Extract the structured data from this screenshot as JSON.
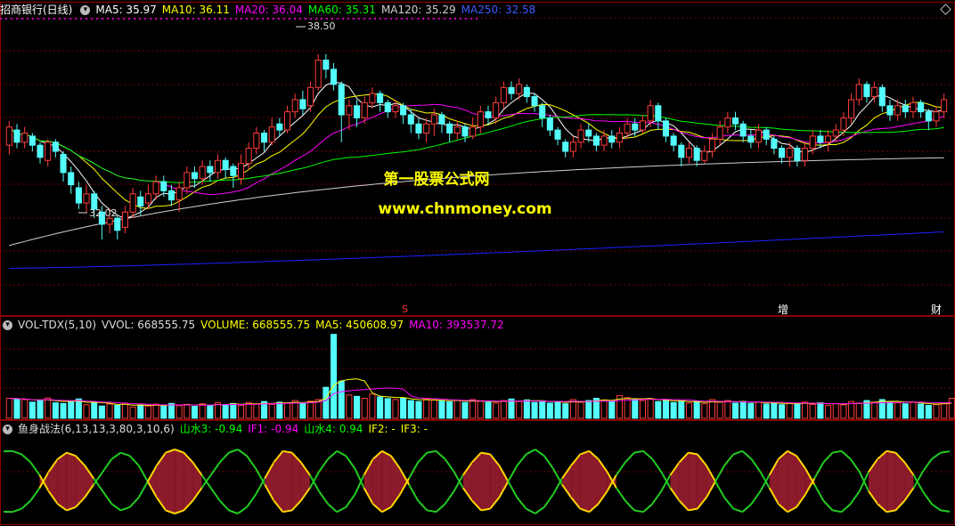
{
  "main_header": {
    "title": "招商银行(日线)",
    "ma5": "MA5: 35.97",
    "ma10": "MA10: 36.11",
    "ma20": "MA20: 36.04",
    "ma60": "MA60: 35.31",
    "ma120": "MA120: 35.29",
    "ma250": "MA250: 32.58"
  },
  "vol_header": {
    "name": "VOL-TDX(5,10)",
    "vvol": "VVOL: 668555.75",
    "volume": "VOLUME: 668555.75",
    "ma5": "MA5: 450608.97",
    "ma10": "MA10: 393537.72"
  },
  "ind_header": {
    "name": "鱼身战法(6,13,13,3,80,3,10,6)",
    "s3": "山水3: -0.94",
    "if1": "IF1: -0.94",
    "s4": "山水4: 0.94",
    "if2": "IF2: -",
    "if3": "IF3: -"
  },
  "watermark": {
    "line1": "第一股票公式网",
    "line2": "www.chnmoney.com"
  },
  "marks": {
    "high": "38.50",
    "low": "32.02",
    "s": "S",
    "zeng": "增",
    "cai": "财"
  },
  "colors": {
    "up": "#ff3c3c",
    "down": "#54fcfc",
    "ma5": "#ffffff",
    "ma10": "#ffff00",
    "ma20": "#ff00ff",
    "ma60": "#00ff00",
    "ma120": "#d0d0d0",
    "ma250": "#2020ff",
    "fish_fill": "#8b1a2b",
    "fish_edge": "#ffd700",
    "fish_line": "#22cc22",
    "accent": "#dd44dd"
  },
  "chart_data": [
    {
      "type": "candlestick",
      "title": "招商银行(日线)",
      "price_high_label": 38.5,
      "price_low_label": 32.02,
      "ylim": [
        31.2,
        39.4
      ],
      "grid": true,
      "ma_last": {
        "MA5": 35.97,
        "MA10": 36.11,
        "MA20": 36.04,
        "MA60": 35.31,
        "MA120": 35.29,
        "MA250": 32.58
      },
      "candles": [
        [
          35.5,
          36.1,
          36.3,
          35.2
        ],
        [
          36.0,
          35.6,
          36.2,
          35.4
        ],
        [
          35.6,
          35.9,
          36.1,
          35.4
        ],
        [
          35.8,
          35.5,
          35.9,
          35.3
        ],
        [
          35.5,
          35.1,
          35.6,
          34.9
        ],
        [
          35.0,
          35.6,
          35.7,
          34.8
        ],
        [
          35.6,
          35.3,
          35.7,
          35.1
        ],
        [
          35.2,
          34.6,
          35.3,
          34.3
        ],
        [
          34.6,
          34.2,
          34.8,
          33.9
        ],
        [
          34.1,
          33.6,
          34.3,
          33.4
        ],
        [
          33.6,
          33.9,
          34.2,
          33.3
        ],
        [
          33.9,
          33.4,
          34.0,
          33.1
        ],
        [
          33.3,
          32.9,
          33.5,
          32.4
        ],
        [
          32.9,
          33.1,
          33.4,
          32.6
        ],
        [
          33.1,
          32.7,
          33.2,
          32.4
        ],
        [
          32.8,
          33.3,
          33.5,
          32.6
        ],
        [
          33.3,
          33.9,
          34.1,
          33.1
        ],
        [
          33.8,
          33.5,
          34.0,
          33.2
        ],
        [
          33.6,
          33.9,
          34.2,
          33.4
        ],
        [
          33.9,
          34.3,
          34.5,
          33.7
        ],
        [
          34.3,
          34.0,
          34.5,
          33.8
        ],
        [
          34.0,
          33.7,
          34.2,
          33.5
        ],
        [
          33.7,
          34.1,
          34.3,
          33.3
        ],
        [
          34.1,
          34.6,
          34.8,
          33.9
        ],
        [
          34.6,
          34.4,
          34.8,
          34.1
        ],
        [
          34.4,
          34.8,
          35.0,
          34.2
        ],
        [
          34.8,
          34.6,
          35.0,
          34.3
        ],
        [
          34.6,
          35.0,
          35.2,
          34.4
        ],
        [
          35.0,
          34.7,
          35.1,
          34.4
        ],
        [
          34.8,
          34.5,
          34.9,
          34.1
        ],
        [
          34.4,
          34.9,
          35.2,
          34.2
        ],
        [
          34.9,
          35.4,
          35.6,
          34.7
        ],
        [
          35.4,
          35.9,
          36.1,
          35.2
        ],
        [
          35.9,
          35.6,
          36.0,
          35.3
        ],
        [
          35.6,
          36.1,
          36.4,
          35.5
        ],
        [
          36.2,
          36.0,
          36.4,
          35.8
        ],
        [
          36.0,
          36.6,
          36.8,
          35.9
        ],
        [
          36.6,
          37.0,
          37.2,
          36.4
        ],
        [
          37.0,
          36.7,
          37.3,
          36.5
        ],
        [
          36.8,
          37.4,
          37.6,
          36.6
        ],
        [
          37.4,
          38.3,
          38.5,
          37.3
        ],
        [
          38.3,
          38.0,
          38.5,
          37.7
        ],
        [
          38.0,
          37.5,
          38.2,
          37.3
        ],
        [
          37.5,
          36.5,
          37.6,
          35.6
        ],
        [
          36.5,
          36.8,
          37.0,
          36.0
        ],
        [
          36.8,
          36.4,
          37.0,
          36.1
        ],
        [
          36.4,
          36.9,
          37.1,
          36.2
        ],
        [
          36.9,
          37.2,
          37.4,
          36.7
        ],
        [
          37.2,
          36.9,
          37.3,
          36.6
        ],
        [
          36.9,
          36.6,
          37.0,
          36.4
        ],
        [
          36.6,
          36.8,
          37.0,
          36.4
        ],
        [
          36.8,
          36.5,
          36.9,
          36.2
        ],
        [
          36.5,
          36.2,
          36.7,
          35.9
        ],
        [
          36.2,
          35.9,
          36.4,
          35.7
        ],
        [
          35.9,
          36.2,
          36.4,
          35.6
        ],
        [
          36.2,
          36.5,
          36.7,
          35.8
        ],
        [
          36.5,
          36.2,
          36.6,
          35.9
        ],
        [
          36.2,
          35.9,
          36.3,
          35.6
        ],
        [
          35.9,
          36.1,
          36.3,
          35.7
        ],
        [
          36.1,
          35.8,
          36.2,
          35.6
        ],
        [
          35.8,
          36.1,
          36.4,
          35.7
        ],
        [
          36.1,
          36.6,
          36.8,
          35.9
        ],
        [
          36.6,
          36.4,
          36.8,
          36.2
        ],
        [
          36.4,
          36.9,
          37.1,
          36.2
        ],
        [
          36.9,
          37.4,
          37.6,
          36.7
        ],
        [
          37.4,
          37.2,
          37.6,
          37.0
        ],
        [
          37.2,
          37.5,
          37.7,
          37.0
        ],
        [
          37.4,
          37.1,
          37.5,
          36.9
        ],
        [
          37.1,
          36.8,
          37.2,
          36.6
        ],
        [
          36.8,
          36.4,
          36.9,
          36.1
        ],
        [
          36.4,
          36.0,
          36.5,
          35.8
        ],
        [
          36.0,
          35.7,
          36.1,
          35.5
        ],
        [
          35.6,
          35.3,
          35.7,
          35.1
        ],
        [
          35.3,
          35.6,
          35.8,
          35.1
        ],
        [
          35.6,
          36.0,
          36.2,
          35.4
        ],
        [
          36.0,
          35.8,
          36.2,
          35.6
        ],
        [
          35.8,
          35.5,
          35.9,
          35.3
        ],
        [
          35.5,
          35.8,
          36.0,
          35.3
        ],
        [
          35.8,
          35.6,
          36.0,
          35.4
        ],
        [
          35.6,
          35.9,
          36.1,
          35.4
        ],
        [
          35.9,
          36.2,
          36.4,
          35.7
        ],
        [
          36.2,
          36.0,
          36.4,
          35.8
        ],
        [
          36.0,
          36.3,
          36.5,
          35.9
        ],
        [
          36.3,
          36.8,
          37.0,
          36.1
        ],
        [
          36.8,
          36.3,
          36.9,
          36.0
        ],
        [
          36.3,
          35.8,
          36.4,
          35.6
        ],
        [
          35.8,
          35.5,
          35.9,
          35.3
        ],
        [
          35.5,
          35.1,
          35.6,
          34.8
        ],
        [
          35.1,
          35.4,
          35.6,
          34.9
        ],
        [
          35.4,
          35.0,
          35.5,
          34.8
        ],
        [
          35.0,
          35.3,
          35.5,
          34.9
        ],
        [
          35.3,
          35.7,
          35.9,
          35.1
        ],
        [
          35.7,
          36.1,
          36.3,
          35.5
        ],
        [
          36.1,
          36.4,
          36.6,
          35.9
        ],
        [
          36.4,
          36.2,
          36.6,
          36.0
        ],
        [
          36.2,
          35.8,
          36.3,
          35.6
        ],
        [
          35.8,
          35.6,
          36.0,
          35.4
        ],
        [
          35.6,
          36.0,
          36.2,
          35.4
        ],
        [
          36.0,
          35.7,
          36.1,
          35.5
        ],
        [
          35.7,
          35.4,
          35.8,
          35.2
        ],
        [
          35.4,
          35.1,
          35.5,
          34.9
        ],
        [
          35.1,
          35.4,
          35.6,
          34.8
        ],
        [
          35.4,
          35.0,
          35.5,
          34.8
        ],
        [
          35.0,
          35.4,
          35.6,
          34.8
        ],
        [
          35.4,
          35.8,
          36.0,
          35.2
        ],
        [
          35.8,
          35.6,
          36.0,
          35.4
        ],
        [
          35.6,
          35.8,
          36.0,
          35.3
        ],
        [
          35.8,
          36.0,
          36.2,
          35.6
        ],
        [
          36.0,
          36.4,
          36.6,
          35.8
        ],
        [
          36.4,
          37.0,
          37.2,
          36.2
        ],
        [
          37.0,
          37.5,
          37.7,
          36.8
        ],
        [
          37.5,
          37.1,
          37.6,
          36.9
        ],
        [
          37.1,
          37.4,
          37.6,
          36.9
        ],
        [
          37.4,
          36.8,
          37.5,
          36.6
        ],
        [
          36.8,
          36.5,
          37.0,
          36.3
        ],
        [
          36.5,
          36.8,
          37.0,
          36.3
        ],
        [
          36.8,
          36.6,
          37.0,
          36.4
        ],
        [
          36.6,
          36.9,
          37.1,
          36.4
        ],
        [
          36.9,
          36.6,
          37.0,
          36.4
        ],
        [
          36.6,
          36.3,
          36.7,
          36.0
        ],
        [
          36.3,
          36.6,
          36.8,
          36.1
        ],
        [
          36.6,
          37.0,
          37.2,
          36.4
        ]
      ]
    },
    {
      "type": "bar",
      "title": "VOL-TDX(5,10)",
      "values": [
        62,
        60,
        58,
        50,
        55,
        63,
        48,
        46,
        52,
        60,
        42,
        50,
        38,
        44,
        40,
        47,
        35,
        41,
        38,
        44,
        40,
        46,
        39,
        43,
        37,
        45,
        41,
        48,
        42,
        46,
        40,
        49,
        45,
        52,
        43,
        50,
        48,
        55,
        47,
        53,
        58,
        96,
        260,
        115,
        72,
        68,
        62,
        75,
        66,
        61,
        58,
        63,
        55,
        52,
        60,
        57,
        54,
        51,
        56,
        49,
        58,
        53,
        50,
        47,
        55,
        60,
        52,
        57,
        49,
        54,
        47,
        52,
        45,
        58,
        50,
        55,
        62,
        57,
        53,
        70,
        64,
        59,
        55,
        60,
        52,
        57,
        49,
        54,
        47,
        52,
        45,
        58,
        50,
        55,
        47,
        52,
        46,
        50,
        44,
        49,
        42,
        47,
        45,
        50,
        43,
        48,
        40,
        46,
        42,
        52,
        47,
        55,
        50,
        58,
        52,
        48,
        45,
        50,
        44,
        40,
        42,
        48,
        62
      ]
    },
    {
      "type": "line",
      "title": "鱼身战法(6,13,13,3,80,3,10,6)",
      "values": [
        -0.94,
        -0.95,
        -0.85,
        -0.6,
        -0.2,
        0.3,
        0.7,
        0.9,
        0.8,
        0.5,
        0.1,
        -0.3,
        -0.7,
        -0.9,
        -0.8,
        -0.5,
        0.0,
        0.5,
        0.9,
        1.0,
        0.9,
        0.6,
        0.2,
        -0.2,
        -0.6,
        -0.9,
        -1.0,
        -0.8,
        -0.4,
        0.1,
        0.6,
        0.95,
        0.9,
        0.6,
        0.2,
        -0.3,
        -0.7,
        -0.95,
        -0.8,
        -0.4,
        0.2,
        0.7,
        0.95,
        0.8,
        0.4,
        -0.1,
        -0.6,
        -0.9,
        -0.95,
        -0.7,
        -0.3,
        0.2,
        0.6,
        0.9,
        0.85,
        0.5,
        0.0,
        -0.5,
        -0.85,
        -1.0,
        -0.8,
        -0.4,
        0.1,
        0.5,
        0.85,
        0.95,
        0.7,
        0.3,
        -0.2,
        -0.6,
        -0.9,
        -0.95,
        -0.7,
        -0.3,
        0.2,
        0.6,
        0.9,
        0.85,
        0.5,
        0.0,
        -0.5,
        -0.85,
        -0.95,
        -0.7,
        -0.3,
        0.2,
        0.7,
        0.95,
        0.8,
        0.4,
        -0.1,
        -0.6,
        -0.9,
        -0.95,
        -0.7,
        -0.3,
        0.3,
        0.7,
        0.95,
        0.9,
        0.6,
        0.2,
        -0.3,
        -0.7,
        -0.9,
        -0.94
      ]
    }
  ]
}
